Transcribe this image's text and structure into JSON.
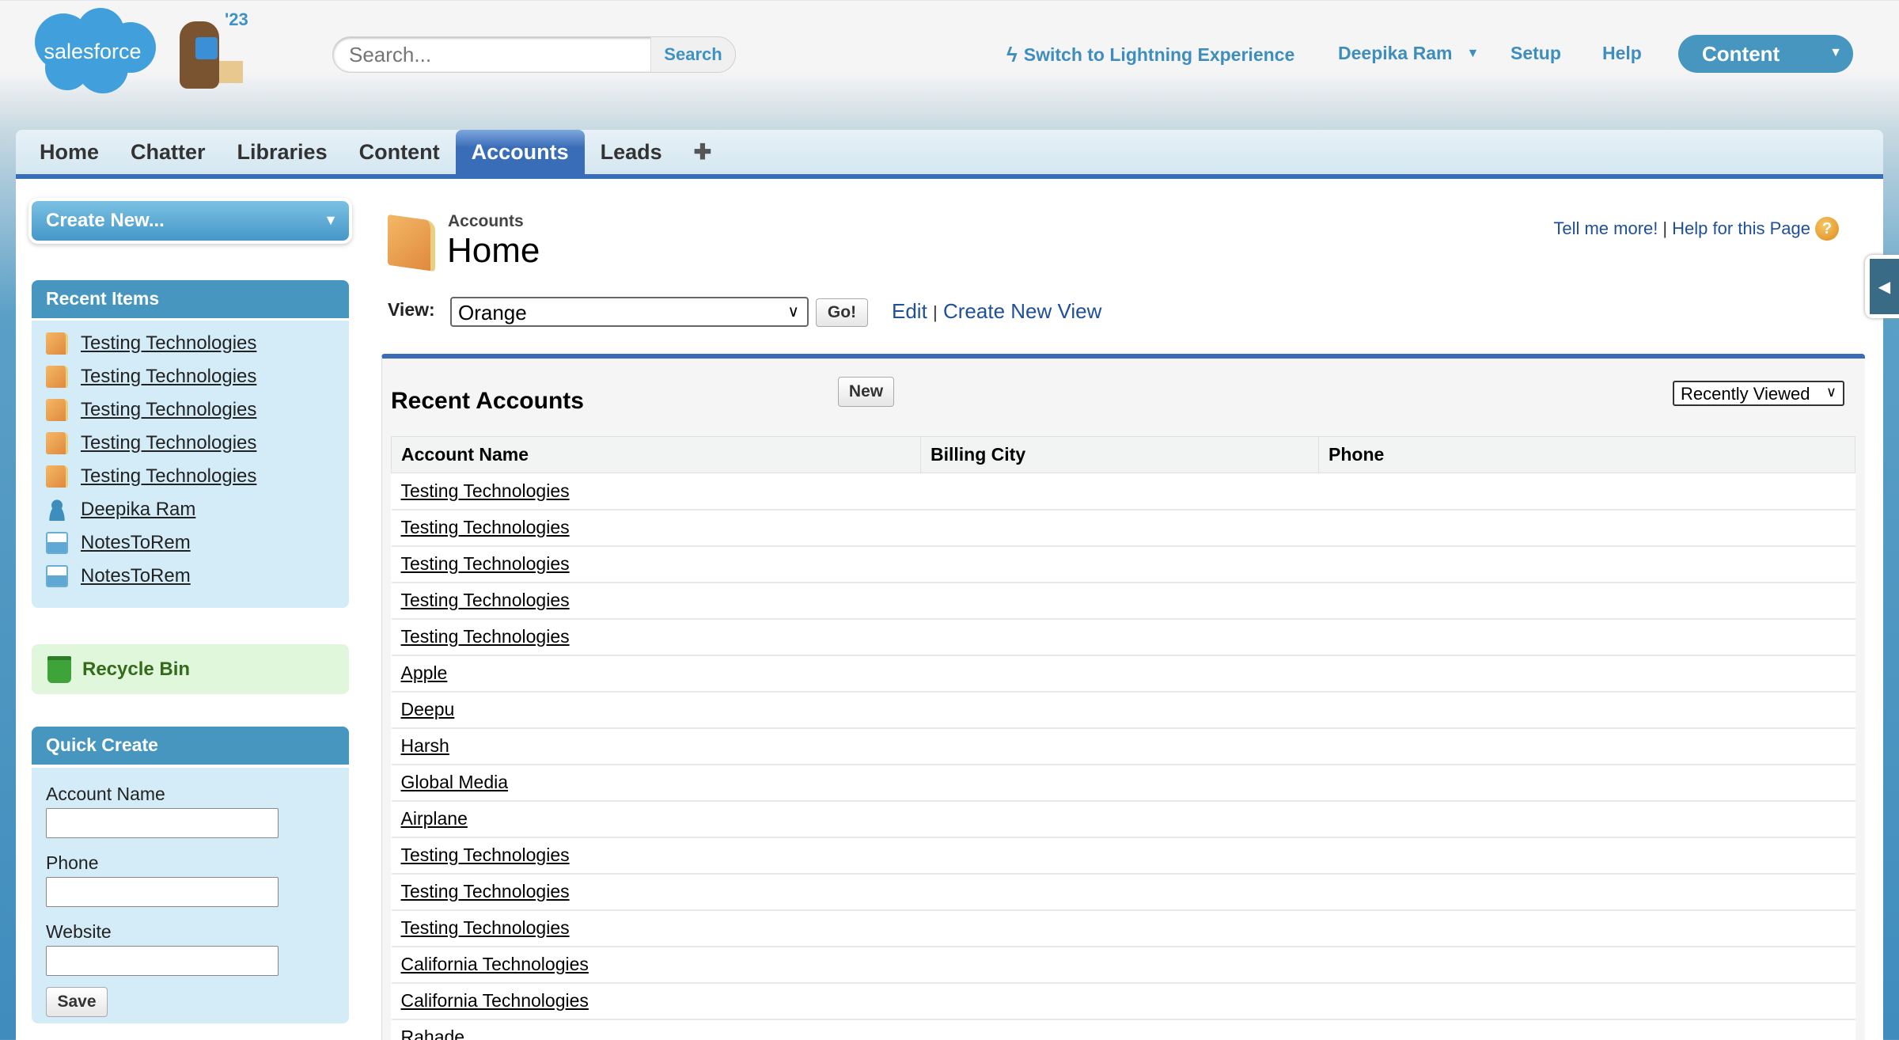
{
  "header": {
    "logo_text": "salesforce",
    "release_badge": "'23",
    "search_placeholder": "Search...",
    "search_button": "Search",
    "lightning_link": "Switch to Lightning Experience",
    "user_menu": "Deepika Ram",
    "setup": "Setup",
    "help": "Help",
    "app_menu": "Content"
  },
  "tabs": [
    {
      "label": "Home"
    },
    {
      "label": "Chatter"
    },
    {
      "label": "Libraries"
    },
    {
      "label": "Content"
    },
    {
      "label": "Accounts",
      "active": true
    },
    {
      "label": "Leads"
    },
    {
      "label": "✚"
    }
  ],
  "sidebar": {
    "create_new": "Create New...",
    "recent_items_title": "Recent Items",
    "recent_items": [
      {
        "label": "Testing Technologies",
        "icon": "account"
      },
      {
        "label": "Testing Technologies",
        "icon": "account"
      },
      {
        "label": "Testing Technologies",
        "icon": "account"
      },
      {
        "label": "Testing Technologies",
        "icon": "account"
      },
      {
        "label": "Testing Technologies",
        "icon": "account"
      },
      {
        "label": "Deepika Ram",
        "icon": "user"
      },
      {
        "label": "NotesToRem",
        "icon": "note"
      },
      {
        "label": "NotesToRem",
        "icon": "note"
      }
    ],
    "recycle_bin": "Recycle Bin",
    "quick_create_title": "Quick Create",
    "quick_create_fields": [
      {
        "label": "Account Name",
        "value": ""
      },
      {
        "label": "Phone",
        "value": ""
      },
      {
        "label": "Website",
        "value": ""
      }
    ],
    "save": "Save"
  },
  "page": {
    "object_type": "Accounts",
    "title": "Home",
    "tell_me_more": "Tell me more!",
    "separator": "|",
    "help_page": "Help for this Page",
    "help_icon": "?",
    "view_label": "View:",
    "view_value": "Orange",
    "go": "Go!",
    "edit": "Edit",
    "create_view": "Create New View"
  },
  "recent": {
    "title": "Recent Accounts",
    "new": "New",
    "filter": "Recently Viewed",
    "columns": [
      "Account Name",
      "Billing City",
      "Phone"
    ],
    "rows": [
      "Testing Technologies",
      "Testing Technologies",
      "Testing Technologies",
      "Testing Technologies",
      "Testing Technologies",
      "Apple",
      "Deepu",
      "Harsh",
      "Global Media",
      "Airplane",
      "Testing Technologies",
      "Testing Technologies",
      "Testing Technologies",
      "California Technologies",
      "California Technologies",
      "Rahade"
    ]
  },
  "colors": {
    "accent": "#4796c0",
    "tab_active": "#3a6db8",
    "link": "#1f4f99"
  }
}
